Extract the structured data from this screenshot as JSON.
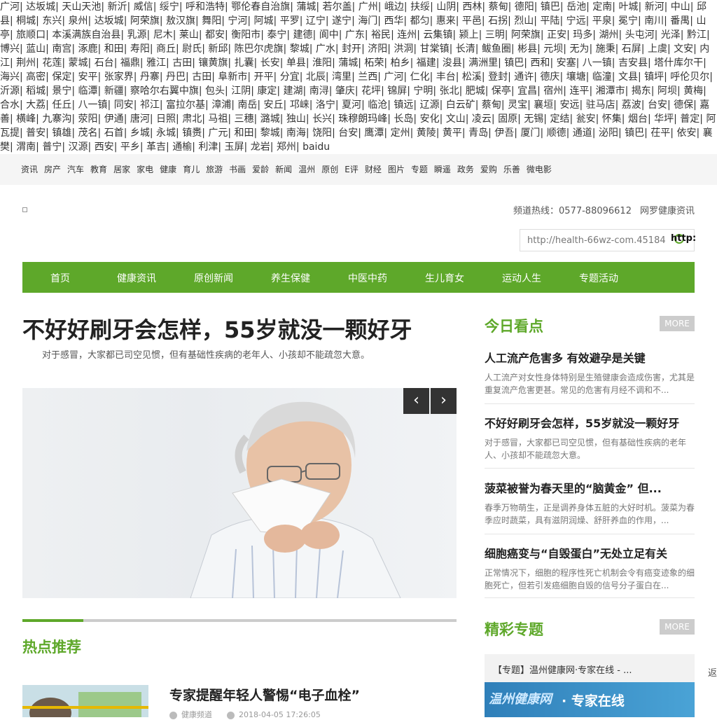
{
  "city_cloud": [
    "广河",
    "达坂城",
    "天山天池",
    "新沂",
    "威信",
    "绥宁",
    "呼和浩特",
    "鄂伦春自治旗",
    "蒲城",
    "若尔盖",
    "广州",
    "峨边",
    "扶绥",
    "山阴",
    "西林",
    "蔡甸",
    "德阳",
    "镇巴",
    "岳池",
    "定南",
    "叶城",
    "新河",
    "中山",
    "邱县",
    "桐城",
    "东兴",
    "泉州",
    "达坂城",
    "阿荣旗",
    "敖汉旗",
    "舞阳",
    "宁河",
    "阿城",
    "平罗",
    "辽宁",
    "遂宁",
    "海门",
    "西华",
    "都匀",
    "惠来",
    "平邑",
    "石拐",
    "烈山",
    "平陆",
    "宁远",
    "平泉",
    "冕宁",
    "南川",
    "番禺",
    "山亭",
    "旅顺口",
    "本溪满族自治县",
    "乳源",
    "尼木",
    "莱山",
    "都安",
    "衡阳市",
    "泰宁",
    "建德",
    "阆中",
    "广东",
    "裕民",
    "连州",
    "云集镇",
    "颍上",
    "三明",
    "阿荣旗",
    "正安",
    "玛多",
    "湖州",
    "头屯河",
    "光泽",
    "黔江",
    "博兴",
    "蓝山",
    "南宫",
    "涿鹿",
    "和田",
    "寿阳",
    "商丘",
    "尉氏",
    "新邱",
    "陈巴尔虎旗",
    "黎城",
    "广水",
    "封开",
    "济阳",
    "洪洞",
    "甘棠镇",
    "长清",
    "鲅鱼圈",
    "彬县",
    "元坝",
    "无为",
    "施秉",
    "石屏",
    "上虞",
    "文安",
    "内江",
    "荆州",
    "花莲",
    "蒙城",
    "石台",
    "福鼎",
    "雅江",
    "古田",
    "镶黄旗",
    "扎囊",
    "长安",
    "单县",
    "淮阳",
    "蒲城",
    "柘荣",
    "柏乡",
    "福建",
    "浚县",
    "满洲里",
    "镇巴",
    "西和",
    "安塞",
    "八一镇",
    "吉安县",
    "塔什库尔干",
    "海兴",
    "高密",
    "保定",
    "安平",
    "张家界",
    "丹寨",
    "丹巴",
    "古田",
    "阜新市",
    "开平",
    "分宜",
    "北辰",
    "湾里",
    "兰西",
    "广河",
    "仁化",
    "丰台",
    "松溪",
    "登封",
    "通许",
    "德庆",
    "壤塘",
    "临潼",
    "文县",
    "镇坪",
    "呼伦贝尔",
    "沂源",
    "稻城",
    "景宁",
    "临潭",
    "新疆",
    "察哈尔右翼中旗",
    "包头",
    "江阴",
    "康定",
    "建湖",
    "南浔",
    "肇庆",
    "花坪",
    "锦屏",
    "宁明",
    "张北",
    "肥城",
    "保亭",
    "宜昌",
    "宿州",
    "连平",
    "湘潭市",
    "揭东",
    "阿坝",
    "黄梅",
    "合水",
    "大荔",
    "任丘",
    "八一镇",
    "同安",
    "祁江",
    "富拉尔基",
    "漳浦",
    "南岳",
    "安丘",
    "邛崃",
    "洛宁",
    "夏河",
    "临沧",
    "镇远",
    "辽源",
    "白云矿",
    "蔡甸",
    "灵宝",
    "襄垣",
    "安远",
    "驻马店",
    "荔波",
    "台安",
    "德保",
    "嘉善",
    "横峰",
    "九寨沟",
    "荥阳",
    "伊通",
    "唐河",
    "日照",
    "肃北",
    "马祖",
    "三穗",
    "潞城",
    "独山",
    "长兴",
    "珠穆朗玛峰",
    "长岛",
    "安化",
    "文山",
    "凌云",
    "固原",
    "无锡",
    "定结",
    "瓮安",
    "怀集",
    "烟台",
    "华坪",
    "普定",
    "阿瓦提",
    "普安",
    "镇雄",
    "茂名",
    "石首",
    "乡城",
    "永城",
    "镇赉",
    "广元",
    "和田",
    "黎城",
    "南海",
    "饶阳",
    "台安",
    "鹰潭",
    "定州",
    "黄陵",
    "黄平",
    "青岛",
    "伊吾",
    "厦门",
    "顺德",
    "通道",
    "泌阳",
    "镇巴",
    "茌平",
    "依安",
    "襄樊",
    "渭南",
    "普宁",
    "汉源",
    "西安",
    "平乡",
    "革吉",
    "通榆",
    "利津",
    "玉屏",
    "龙岩",
    "郑州",
    "baidu"
  ],
  "category_bar": [
    "资讯",
    "房产",
    "汽车",
    "教育",
    "居家",
    "家电",
    "健康",
    "育儿",
    "旅游",
    "书画",
    "爱龄",
    "新闻",
    "温州",
    "原创",
    "E评",
    "财经",
    "图片",
    "专题",
    "瞬遥",
    "政务",
    "爱购",
    "乐善",
    "微电影"
  ],
  "header": {
    "hotline": "频道热线：0577-88096612",
    "site_name": "网罗健康资讯",
    "search_value": "http://health-66wz-com.45184",
    "search_button": "http:"
  },
  "nav": [
    "首页",
    "健康资讯",
    "原创新闻",
    "养生保健",
    "中医中药",
    "生儿育女",
    "运动人生",
    "专题活动"
  ],
  "main": {
    "headline": "不好好刷牙会怎样，55岁就没一颗好牙",
    "summary": "对于感冒，大家都已司空见惯，但有基础性疾病的老年人、小孩却不能疏忽大意。",
    "arrow_prev": "‹",
    "arrow_next": "›",
    "slider_progress_percent": 14
  },
  "hot": {
    "title": "热点推荐",
    "item_title": "专家提醒年轻人警惕“电子血栓”",
    "item_channel": "健康频道",
    "item_time": "2018-04-05 17:26:05"
  },
  "today": {
    "title": "今日看点",
    "more": "MORE",
    "items": [
      {
        "title": "人工流产危害多 有效避孕是关键",
        "desc": "人工流产对女性身体特别是生殖健康会造成伤害，尤其是重复流产危害更甚。常见的危害有月经不调和不..."
      },
      {
        "title": "不好好刷牙会怎样，55岁就没一颗好牙",
        "desc": "对于感冒，大家都已司空见惯，但有基础性疾病的老年人、小孩却不能疏忽大意。"
      },
      {
        "title": "菠菜被誉为春天里的“脑黄金” 但...",
        "desc": "春季万物萌生，正是调养身体五脏的大好时机。菠菜为春季应时蔬菜，具有滋阴润燥、舒肝养血的作用，..."
      },
      {
        "title": "细胞癌变与“自毁蛋白”无处立足有关",
        "desc": "正常情况下，细胞的程序性死亡机制会令有癌变迹象的细胞死亡，但若引发癌细胞自毁的信号分子蛋白在..."
      }
    ]
  },
  "topics": {
    "title": "精彩专题",
    "more": "MORE",
    "item_title": "【专题】温州健康网·专家在线 - ...",
    "banner_logo": "温州健康网",
    "banner_text": "· 专家在线"
  },
  "side_link": "返",
  "colors": {
    "brand_green": "#5ea82a",
    "more_gray": "#cccccc"
  }
}
